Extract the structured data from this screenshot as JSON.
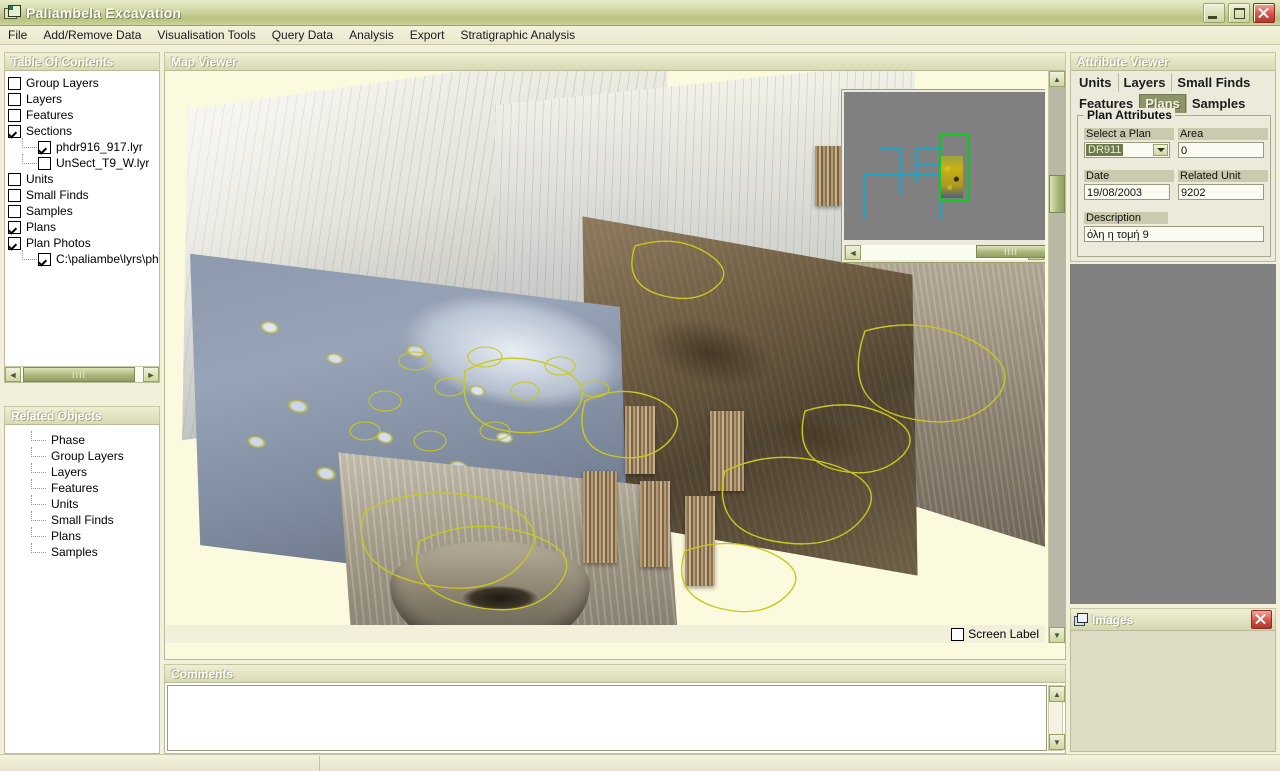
{
  "window": {
    "title": "Paliambela Excavation",
    "icon": "application-icon",
    "buttons": {
      "minimize": "minimize-button",
      "maximize": "maximize-button",
      "close": "close-button"
    }
  },
  "menubar": {
    "items": [
      "File",
      "Add/Remove Data",
      "Visualisation Tools",
      "Query Data",
      "Analysis",
      "Export",
      "Stratigraphic Analysis"
    ]
  },
  "table_of_contents": {
    "title": "Table Of Contents",
    "items": [
      {
        "label": "Group Layers",
        "checked": false,
        "child": false
      },
      {
        "label": "Layers",
        "checked": false,
        "child": false
      },
      {
        "label": "Features",
        "checked": false,
        "child": false
      },
      {
        "label": "Sections",
        "checked": true,
        "child": false
      },
      {
        "label": "phdr916_917.lyr",
        "checked": true,
        "child": true
      },
      {
        "label": "UnSect_T9_W.lyr",
        "checked": false,
        "child": true
      },
      {
        "label": "Units",
        "checked": false,
        "child": false
      },
      {
        "label": "Small Finds",
        "checked": false,
        "child": false
      },
      {
        "label": "Samples",
        "checked": false,
        "child": false
      },
      {
        "label": "Plans",
        "checked": true,
        "child": false
      },
      {
        "label": "Plan Photos",
        "checked": true,
        "child": false
      },
      {
        "label": "C:\\paliambe\\lyrs\\ph",
        "checked": true,
        "child": true
      }
    ],
    "scrollbar": {
      "left_arrow": "◄",
      "right_arrow": "►",
      "grip": "IIII"
    }
  },
  "related_objects": {
    "title": "Related Objects",
    "items": [
      "Phase",
      "Group Layers",
      "Layers",
      "Features",
      "Units",
      "Small Finds",
      "Plans",
      "Samples"
    ]
  },
  "map_viewer": {
    "title": "Map Viewer",
    "screen_label": {
      "label": "Screen Label",
      "checked": false
    },
    "vertical_scrollbar": {
      "up_arrow": "▲",
      "down_arrow": "▼"
    },
    "overview": {
      "name": "overview-inset",
      "left_arrow": "◄",
      "right_arrow": "►",
      "grip": "IIII"
    }
  },
  "comments": {
    "title": "Comments",
    "value": "",
    "placeholder": ""
  },
  "attribute_viewer": {
    "title": "Attribute Viewer",
    "tabs_row1": [
      {
        "label": "Units",
        "active": false
      },
      {
        "label": "Layers",
        "active": false
      },
      {
        "label": "Small Finds",
        "active": false
      }
    ],
    "tabs_row2": [
      {
        "label": "Features",
        "active": false
      },
      {
        "label": "Plans",
        "active": true
      },
      {
        "label": "Samples",
        "active": false
      }
    ],
    "group_title": "Plan Attributes",
    "fields": {
      "select_a_plan": {
        "label": "Select a Plan",
        "value": "DR911"
      },
      "area": {
        "label": "Area",
        "value": "0"
      },
      "date": {
        "label": "Date",
        "value": "19/08/2003"
      },
      "related_unit": {
        "label": "Related Unit",
        "value": "9202"
      },
      "description": {
        "label": "Description",
        "value": "όλη η τομή 9"
      }
    }
  },
  "images_panel": {
    "title": "Images",
    "icon": "images-window-icon",
    "close": "close-images-button"
  },
  "colors": {
    "titlebar_accent": "#b9c183",
    "tab_active": "#8d9468",
    "panel_bg": "#eceada",
    "app_bg": "#f2f0da",
    "gray_fill": "#808080",
    "overview_rect": "#19a6c9",
    "overview_active_rect": "#00d21a",
    "close_button": "#d9534a"
  }
}
